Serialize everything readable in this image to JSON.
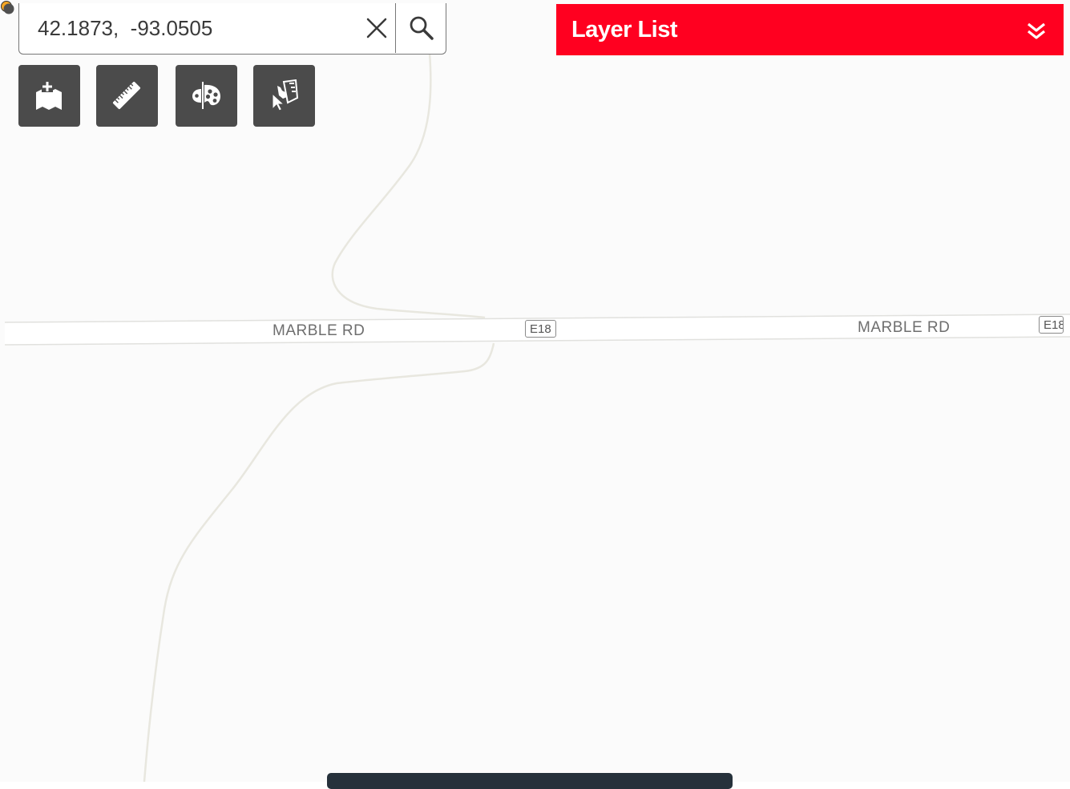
{
  "search": {
    "value": "42.1873,  -93.0505"
  },
  "icons": {
    "clear": "close-icon",
    "search": "search-icon",
    "add_data": "add-data-icon",
    "measure": "ruler-icon",
    "basemap": "basemap-palette-icon",
    "select": "select-cursor-icon",
    "expand": "chevron-double-down-icon"
  },
  "toolbar": {
    "tools": [
      "add-data",
      "measure",
      "basemap-gallery",
      "select"
    ]
  },
  "layer_list": {
    "title": "Layer List"
  },
  "map": {
    "roads": [
      {
        "name": "MARBLE RD",
        "shield": "E18"
      },
      {
        "name": "MARBLE RD",
        "shield": "E18"
      }
    ],
    "marker_colors": [
      "#f5a623",
      "#505050"
    ]
  },
  "colors": {
    "header_red": "#ff0020",
    "tool_gray": "#4b4b4b",
    "map_bg": "#fbfbfb"
  }
}
